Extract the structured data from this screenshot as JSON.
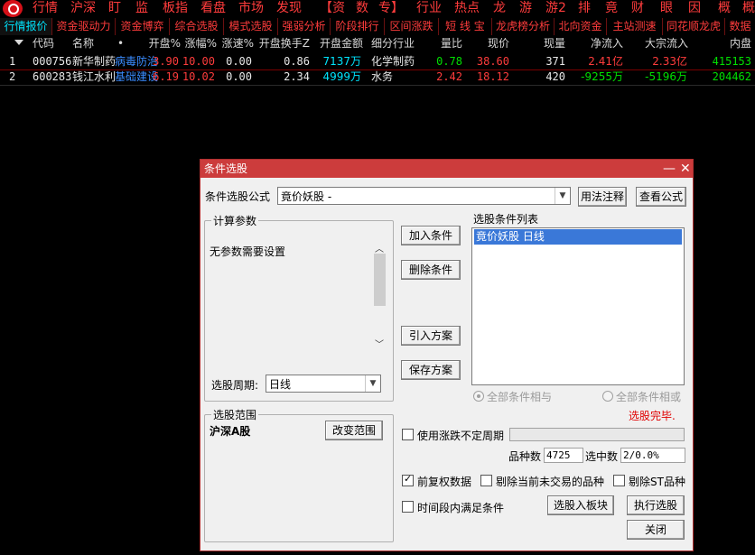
{
  "menu": [
    "行情",
    "沪深",
    "盯",
    "监",
    "板指",
    "看盘",
    "市场",
    "发现",
    "【资",
    "数",
    "专】",
    "行业",
    "热点",
    "龙",
    "游",
    "游2",
    "排",
    "竟",
    "财",
    "眼",
    "因",
    "概",
    "概"
  ],
  "tabs": [
    "行情报价",
    "资金驱动力",
    "资金博弈",
    "综合选股",
    "模式选股",
    "强弱分析",
    "阶段排行",
    "区间涨跌",
    "短 线 宝",
    "龙虎榜分析",
    "北向资金",
    "主站测速",
    "同花顺龙虎",
    "数据"
  ],
  "active_tab": 0,
  "table": {
    "headers": [
      "代码",
      "名称",
      "•",
      "开盘%",
      "涨幅%",
      "涨速%",
      "开盘换手Z",
      "开盘金额",
      "细分行业",
      "量比",
      "现价",
      "现量",
      "净流入",
      "大宗流入",
      "内盘"
    ],
    "rows": [
      {
        "idx": "1",
        "code": "000756",
        "name": "新华制药",
        "tag": "病毒防治",
        "open_pct": "3.90",
        "chg": "10.00",
        "speed": "0.00",
        "turnover": "0.86",
        "amount": "7137万",
        "industry": "化学制药",
        "vol_ratio": "0.78",
        "price": "38.60",
        "cur_vol": "371",
        "net_in": "2.41亿",
        "block_in": "2.33亿",
        "inner": "415153"
      },
      {
        "idx": "2",
        "code": "600283",
        "name": "钱江水利",
        "tag": "基础建设",
        "open_pct": "6.19",
        "chg": "10.02",
        "speed": "0.00",
        "turnover": "2.34",
        "amount": "4999万",
        "industry": "水务",
        "vol_ratio": "2.42",
        "price": "18.12",
        "cur_vol": "420",
        "net_in": "-9255万",
        "block_in": "-5196万",
        "inner": "204462"
      }
    ]
  },
  "dialog": {
    "title": "条件选股",
    "formula_label": "条件选股公式",
    "formula_value": "竟价妖股        -",
    "usage_btn": "用法注释",
    "view_btn": "查看公式",
    "calc_params_label": "计算参数",
    "no_params": "无参数需要设置",
    "period_label": "选股周期:",
    "period_value": "日线",
    "range_label": "选股范围",
    "range_value": "沪深A股",
    "change_range_btn": "改变范围",
    "add_btn": "加入条件",
    "del_btn": "删除条件",
    "import_btn": "引入方案",
    "save_btn": "保存方案",
    "list_label": "选股条件列表",
    "list_items": [
      "竟价妖股   日线"
    ],
    "radio_and": "全部条件相与",
    "radio_or": "全部条件相或",
    "status": "选股完毕.",
    "use_uncertain_period": "使用涨跌不定周期",
    "count_label": "品种数",
    "count_value": "4725",
    "hit_label": "选中数",
    "hit_value": "2/0.0%",
    "fq_label": "前复权数据",
    "fq_checked": true,
    "exclude_untraded": "剔除当前未交易的品种",
    "exclude_st": "剔除ST品种",
    "period_satisfy": "时间段内满足条件",
    "to_block_btn": "选股入板块",
    "run_btn": "执行选股",
    "close_btn": "关闭"
  },
  "colors": {
    "up": "#ff3c3c",
    "down": "#00e000",
    "cyan": "#00e5ff",
    "yellow": "#ffff00",
    "white": "#e8e8e8",
    "status_red": "#e00000",
    "select_blue": "#3a78d8"
  }
}
